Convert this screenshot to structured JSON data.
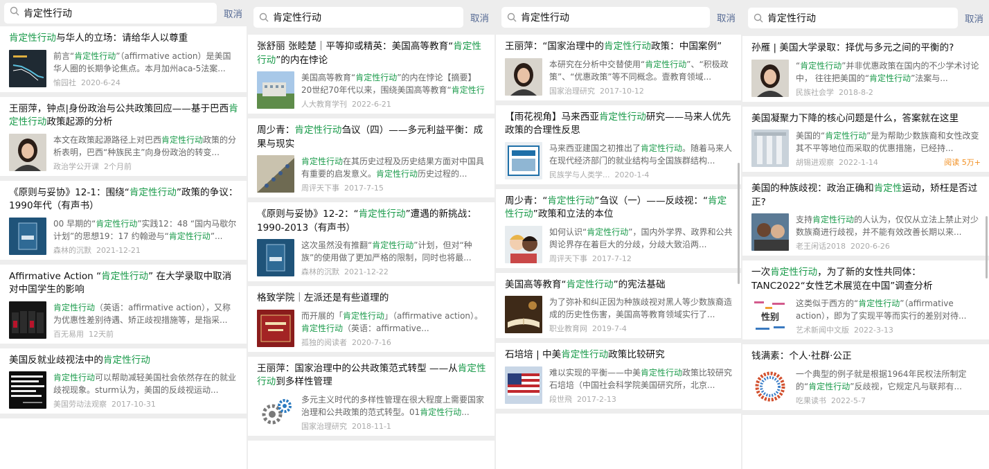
{
  "search": {
    "query": "肯定性行动",
    "cancel_label": "取消"
  },
  "panels": [
    {
      "items": [
        {
          "title": [
            {
              "t": "肯定性行动",
              "hl": true
            },
            {
              "t": "与华人的立场：请给华人以尊重"
            }
          ],
          "snippet": [
            {
              "t": "前言“"
            },
            {
              "t": "肯定性行动",
              "hl": true
            },
            {
              "t": "”（affirmative action）是美国华人圈的长期争论焦点。本月加州aca-5法案..."
            }
          ],
          "source": "愉园社",
          "date": "2020-6-24",
          "thumb": "dark-chart"
        },
        {
          "title": [
            {
              "t": "王丽萍，钟点|身份政治与公共政策回应——基于巴西"
            },
            {
              "t": "肯定性行动",
              "hl": true
            },
            {
              "t": "政策起源的分析"
            }
          ],
          "snippet": [
            {
              "t": "本文在政策起源路径上对巴西"
            },
            {
              "t": "肯定性行动",
              "hl": true
            },
            {
              "t": "政策的分析表明，巴西“种族民主”向身份政治的转变..."
            }
          ],
          "source": "政治学公开课",
          "date": "2个月前",
          "thumb": "portrait-woman"
        },
        {
          "title": [
            {
              "t": "《原则与妥协》12-1：围绕“"
            },
            {
              "t": "肯定性行动",
              "hl": true
            },
            {
              "t": "”政策的争议：1990年代（有声书）"
            }
          ],
          "snippet": [
            {
              "t": "00 早期的“"
            },
            {
              "t": "肯定性行动",
              "hl": true
            },
            {
              "t": "”实践12：48 “国内马歇尔计划”的思想19：17 约翰逊与“"
            },
            {
              "t": "肯定性行动",
              "hl": true
            },
            {
              "t": "”..."
            }
          ],
          "source": "森林的沉默",
          "date": "2021-12-21",
          "thumb": "blue-book"
        },
        {
          "title": [
            {
              "t": "Affirmative Action “"
            },
            {
              "t": "肯定性行动",
              "hl": true
            },
            {
              "t": "” 在大学录取中取消对中国学生的影响"
            }
          ],
          "snippet": [
            {
              "t": "肯定性行动",
              "hl": true
            },
            {
              "t": "（英语：affirmative action），又称为优惠性差别待遇、矫正歧视措施等，是指采..."
            }
          ],
          "source": "百无易用",
          "date": "12天前",
          "thumb": "dark-court"
        },
        {
          "title": [
            {
              "t": "美国反就业歧视法中的"
            },
            {
              "t": "肯定性行动",
              "hl": true
            }
          ],
          "snippet": [
            {
              "t": "肯定性行动",
              "hl": true
            },
            {
              "t": "可以帮助减轻美国社会依然存在的就业歧视现象。sturm认为，美国的反歧视运动..."
            }
          ],
          "source": "美国劳动法观察",
          "date": "2017-10-31",
          "thumb": "quote-card"
        }
      ]
    },
    {
      "items": [
        {
          "title": [
            {
              "t": "张舒丽 张睦楚｜平等抑或精英：美国高等教育“"
            },
            {
              "t": "肯定性行动",
              "hl": true
            },
            {
              "t": "”的内在悖论"
            }
          ],
          "snippet": [
            {
              "t": "美国高等教育“"
            },
            {
              "t": "肯定性行动",
              "hl": true
            },
            {
              "t": "”的内在悖论【摘要】20世纪70年代以来，围绕美国高等教育“"
            },
            {
              "t": "肯定性行动",
              "hl": true
            },
            {
              "t": "”..."
            }
          ],
          "source": "人大教育学刊",
          "date": "2022-6-21",
          "thumb": "campus"
        },
        {
          "title": [
            {
              "t": "周少青："
            },
            {
              "t": "肯定性行动",
              "hl": true
            },
            {
              "t": "刍议（四）——多元利益平衡：成果与现实"
            }
          ],
          "snippet": [
            {
              "t": "肯定性行动",
              "hl": true
            },
            {
              "t": "在其历史过程及历史结果方面对中国具有重要的启发意义。"
            },
            {
              "t": "肯定性行动",
              "hl": true
            },
            {
              "t": "历史过程的..."
            }
          ],
          "source": "周评天下事",
          "date": "2017-7-15",
          "thumb": "climbers"
        },
        {
          "title": [
            {
              "t": "《原则与妥协》12-2：“"
            },
            {
              "t": "肯定性行动",
              "hl": true
            },
            {
              "t": "”遭遇的新挑战：1990-2013（有声书）"
            }
          ],
          "snippet": [
            {
              "t": "这次虽然没有推翻“"
            },
            {
              "t": "肯定性行动",
              "hl": true
            },
            {
              "t": "”计划，但对“种族”的使用做了更加严格的限制，同时也将最..."
            }
          ],
          "source": "森林的沉默",
          "date": "2021-12-22",
          "thumb": "blue-book"
        },
        {
          "title": [
            {
              "t": "格致学院｜左派还是有些道理的"
            }
          ],
          "snippet": [
            {
              "t": "而开展的「"
            },
            {
              "t": "肯定性行动",
              "hl": true
            },
            {
              "t": "」（affirmative action）。"
            },
            {
              "t": "肯定性行动",
              "hl": true
            },
            {
              "t": "（英语：affirmative..."
            }
          ],
          "source": "孤独的阅读者",
          "date": "2020-7-16",
          "thumb": "red-book"
        },
        {
          "title": [
            {
              "t": "王丽萍：国家治理中的公共政策范式转型 ——从"
            },
            {
              "t": "肯定性行动",
              "hl": true
            },
            {
              "t": "到多样性管理"
            }
          ],
          "snippet": [
            {
              "t": "多元主义时代的多样性管理在很大程度上需要国家治理和公共政策的范式转型。01"
            },
            {
              "t": "肯定性行动",
              "hl": true
            },
            {
              "t": "..."
            }
          ],
          "source": "国家治理研究",
          "date": "2018-11-1",
          "thumb": "gears"
        }
      ]
    },
    {
      "items": [
        {
          "title": [
            {
              "t": "王丽萍：“国家治理中的"
            },
            {
              "t": "肯定性行动",
              "hl": true
            },
            {
              "t": "政策：中国案例”"
            }
          ],
          "snippet": [
            {
              "t": "本研究在分析中交替使用“"
            },
            {
              "t": "肯定性行动",
              "hl": true
            },
            {
              "t": "”、“积极政策”、“优惠政策”等不同概念。壹教育领域..."
            }
          ],
          "source": "国家治理研究",
          "date": "2017-10-12",
          "thumb": "portrait-woman"
        },
        {
          "title": [
            {
              "t": "【雨花视角】马来西亚"
            },
            {
              "t": "肯定性行动",
              "hl": true
            },
            {
              "t": "研究——马来人优先政策的合理性反思"
            }
          ],
          "snippet": [
            {
              "t": "马来西亚建国之初推出了"
            },
            {
              "t": "肯定性行动",
              "hl": true
            },
            {
              "t": "。随着马来人在现代经济部门的就业结构与全国族群结构..."
            }
          ],
          "source": "民族学与人类学...",
          "date": "2020-1-4",
          "thumb": "journal"
        },
        {
          "title": [
            {
              "t": "周少青：“"
            },
            {
              "t": "肯定性行动",
              "hl": true
            },
            {
              "t": "”刍议（一）——反歧视：“"
            },
            {
              "t": "肯定性行动",
              "hl": true
            },
            {
              "t": "”政策和立法的本位"
            }
          ],
          "snippet": [
            {
              "t": "如何认识“"
            },
            {
              "t": "肯定性行动",
              "hl": true
            },
            {
              "t": "”，国内外学界、政界和公共舆论界存在着巨大的分歧，分歧大致沿两..."
            }
          ],
          "source": "周评天下事",
          "date": "2017-7-12",
          "thumb": "children"
        },
        {
          "title": [
            {
              "t": "美国高等教育“"
            },
            {
              "t": "肯定性行动",
              "hl": true
            },
            {
              "t": "”的宪法基础"
            }
          ],
          "snippet": [
            {
              "t": "为了弥补和纠正因为种族歧视对黑人等少数族裔造成的历史性伤害，美国高等教育领域实行了..."
            }
          ],
          "source": "职业教育网",
          "date": "2019-7-4",
          "thumb": "open-book"
        },
        {
          "title": [
            {
              "t": "石培培 | 中美"
            },
            {
              "t": "肯定性行动",
              "hl": true
            },
            {
              "t": "政策比较研究"
            }
          ],
          "snippet": [
            {
              "t": "难以实现的平衡——中美"
            },
            {
              "t": "肯定性行动",
              "hl": true
            },
            {
              "t": "政策比较研究石培培（中国社会科学院美国研究所，北京..."
            }
          ],
          "source": "段世飛",
          "date": "2017-2-13",
          "thumb": "flag"
        }
      ]
    },
    {
      "items": [
        {
          "title": [
            {
              "t": "孙雁 | 美国大学录取：择优与多元之间的平衡的?"
            }
          ],
          "snippet": [
            {
              "t": "“"
            },
            {
              "t": "肯定性行动",
              "hl": true
            },
            {
              "t": "”并非优惠政策在国内的不少学术讨论中， 往往把美国的“"
            },
            {
              "t": "肯定性行动",
              "hl": true
            },
            {
              "t": "”法案与..."
            }
          ],
          "source": "民族社会学",
          "date": "2018-8-2",
          "thumb": "portrait-woman"
        },
        {
          "title": [
            {
              "t": "美国凝聚力下降的核心问题是什么，答案就在这里"
            }
          ],
          "snippet": [
            {
              "t": "美国的“"
            },
            {
              "t": "肯定性行动",
              "hl": true
            },
            {
              "t": "”是为帮助少数族裔和女性改变其不平等地位而采取的优惠措施，已经持..."
            }
          ],
          "source": "胡锡进观察",
          "date": "2022-1-14",
          "reads": "阅读 5万+",
          "thumb": "columns"
        },
        {
          "title": [
            {
              "t": "美国的种族歧视：政治正确和"
            },
            {
              "t": "肯定性",
              "hl": true
            },
            {
              "t": "运动，矫枉是否过正?"
            }
          ],
          "snippet": [
            {
              "t": "支持"
            },
            {
              "t": "肯定性行动",
              "hl": true
            },
            {
              "t": "的人认为，仅仅从立法上禁止对少数族裔进行歧视，并不能有效改善长期以来..."
            }
          ],
          "source": "老王闲话2018",
          "date": "2020-6-26",
          "thumb": "two-men"
        },
        {
          "title": [
            {
              "t": "一次"
            },
            {
              "t": "肯定性行动",
              "hl": true
            },
            {
              "t": "，为了新的女性共同体：TANC2022“女性艺术展览在中国”调查分析"
            }
          ],
          "snippet": [
            {
              "t": "这类似于西方的“"
            },
            {
              "t": "肯定性行动",
              "hl": true
            },
            {
              "t": "”（affirmative action），即为了实现平等而实行的差别对待..."
            }
          ],
          "source": "艺术新闻中文版",
          "date": "2022-3-13",
          "thumb": "word-cloud",
          "thumb_text": "性别"
        },
        {
          "title": [
            {
              "t": "钱满素：个人·社群·公正"
            }
          ],
          "snippet": [
            {
              "t": "一个典型的例子就是根据1964年民权法所制定的“"
            },
            {
              "t": "肯定性行动",
              "hl": true
            },
            {
              "t": "”反歧视，它规定凡与联邦有..."
            }
          ],
          "source": "吃果读书",
          "date": "2022-5-7",
          "thumb": "crowd-circle"
        }
      ]
    }
  ]
}
